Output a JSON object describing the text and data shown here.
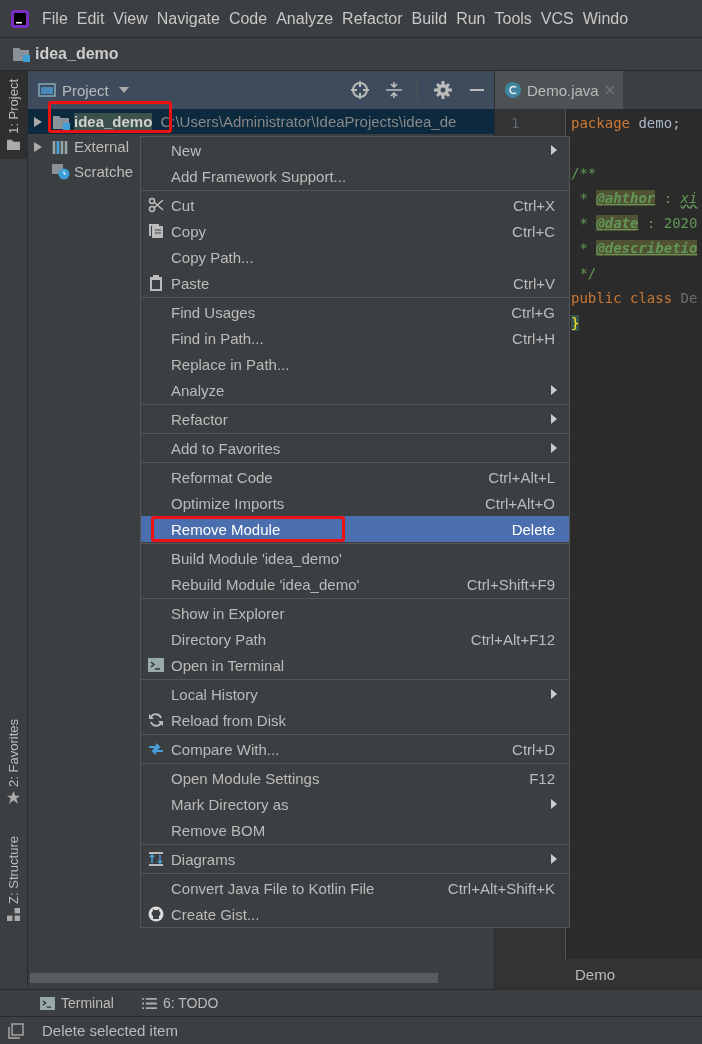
{
  "menu_bar": {
    "items": [
      "File",
      "Edit",
      "View",
      "Navigate",
      "Code",
      "Analyze",
      "Refactor",
      "Build",
      "Run",
      "Tools",
      "VCS",
      "Windo"
    ]
  },
  "nav_bar": {
    "label": "idea_demo"
  },
  "side_tabs": [
    {
      "label": "1: Project",
      "selected": true,
      "kind": "project"
    },
    {
      "label": "2: Favorites",
      "selected": false,
      "kind": "favorites"
    },
    {
      "label": "Z: Structure",
      "selected": false,
      "kind": "structure"
    }
  ],
  "project_panel": {
    "title": "Project",
    "tree": [
      {
        "label": "idea_demo",
        "path": "C:\\Users\\Administrator\\IdeaProjects\\idea_de",
        "kind": "module",
        "selected": true,
        "highlighted": true
      },
      {
        "label": "External",
        "kind": "libraries",
        "selected": false,
        "highlighted": false
      },
      {
        "label": "Scratche",
        "kind": "scratches",
        "selected": false,
        "highlighted": false
      }
    ]
  },
  "editor": {
    "tabs": [
      {
        "label": "Demo.java",
        "selected": true
      }
    ],
    "line_numbers": [
      "1"
    ],
    "lines": [
      {
        "tokens": [
          {
            "text": "package ",
            "kind": "keyword"
          },
          {
            "text": "demo;",
            "kind": "plain"
          }
        ]
      },
      {
        "tokens": [
          {
            "text": "/**",
            "kind": "comment"
          }
        ],
        "blank_before": true
      },
      {
        "tokens": [
          {
            "text": " * ",
            "kind": "comment"
          },
          {
            "text": "@ahthor",
            "kind": "doctag"
          },
          {
            "text": " : ",
            "kind": "comment"
          },
          {
            "text": "xi",
            "kind": "typo"
          }
        ]
      },
      {
        "tokens": [
          {
            "text": " * ",
            "kind": "comment"
          },
          {
            "text": "@date",
            "kind": "doctag"
          },
          {
            "text": " : 2020",
            "kind": "comment"
          }
        ]
      },
      {
        "tokens": [
          {
            "text": " * ",
            "kind": "comment"
          },
          {
            "text": "@describetio",
            "kind": "doctag"
          }
        ]
      },
      {
        "tokens": [
          {
            "text": " */",
            "kind": "comment"
          }
        ]
      },
      {
        "tokens": [
          {
            "text": "public class ",
            "kind": "keyword"
          },
          {
            "text": "De",
            "kind": "dim"
          }
        ]
      },
      {
        "tokens": [
          {
            "text": "}",
            "kind": "brace"
          }
        ]
      }
    ],
    "breadcrumb": "Demo"
  },
  "context_menu": {
    "groups": [
      [
        {
          "label": "New",
          "submenu": true
        },
        {
          "label": "Add Framework Support..."
        }
      ],
      [
        {
          "label": "Cut",
          "shortcut": "Ctrl+X",
          "kind": "cut"
        },
        {
          "label": "Copy",
          "shortcut": "Ctrl+C",
          "kind": "copy"
        },
        {
          "label": "Copy Path..."
        },
        {
          "label": "Paste",
          "shortcut": "Ctrl+V",
          "kind": "paste"
        }
      ],
      [
        {
          "label": "Find Usages",
          "shortcut": "Ctrl+G"
        },
        {
          "label": "Find in Path...",
          "shortcut": "Ctrl+H"
        },
        {
          "label": "Replace in Path..."
        },
        {
          "label": "Analyze",
          "submenu": true
        }
      ],
      [
        {
          "label": "Refactor",
          "submenu": true
        }
      ],
      [
        {
          "label": "Add to Favorites",
          "submenu": true
        }
      ],
      [
        {
          "label": "Reformat Code",
          "shortcut": "Ctrl+Alt+L"
        },
        {
          "label": "Optimize Imports",
          "shortcut": "Ctrl+Alt+O"
        },
        {
          "label": "Remove Module",
          "shortcut": "Delete",
          "selected": true,
          "highlighted": true
        }
      ],
      [
        {
          "label": "Build Module 'idea_demo'"
        },
        {
          "label": "Rebuild Module 'idea_demo'",
          "shortcut": "Ctrl+Shift+F9"
        }
      ],
      [
        {
          "label": "Show in Explorer"
        },
        {
          "label": "Directory Path",
          "shortcut": "Ctrl+Alt+F12"
        },
        {
          "label": "Open in Terminal",
          "kind": "terminal"
        }
      ],
      [
        {
          "label": "Local History",
          "submenu": true
        },
        {
          "label": "Reload from Disk",
          "kind": "reload"
        }
      ],
      [
        {
          "label": "Compare With...",
          "shortcut": "Ctrl+D",
          "kind": "compare"
        }
      ],
      [
        {
          "label": "Open Module Settings",
          "shortcut": "F12"
        },
        {
          "label": "Mark Directory as",
          "submenu": true
        },
        {
          "label": "Remove BOM"
        }
      ],
      [
        {
          "label": "Diagrams",
          "submenu": true,
          "kind": "diagrams"
        }
      ],
      [
        {
          "label": "Convert Java File to Kotlin File",
          "shortcut": "Ctrl+Alt+Shift+K"
        },
        {
          "label": "Create Gist...",
          "kind": "gist"
        }
      ]
    ]
  },
  "tool_windows": [
    {
      "label": "Terminal",
      "kind": "terminal"
    },
    {
      "label": "6: TODO",
      "kind": "todo"
    }
  ],
  "status_bar": {
    "message": "Delete selected item"
  }
}
